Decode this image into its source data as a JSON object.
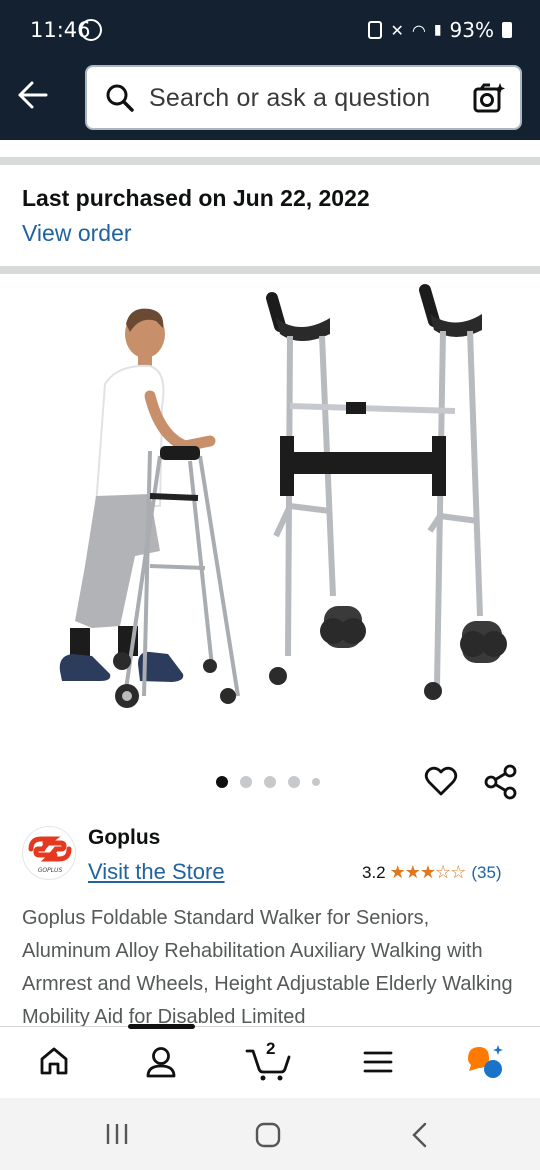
{
  "status_bar": {
    "time": "11:46",
    "battery": "93%"
  },
  "search": {
    "placeholder": "Search or ask a question"
  },
  "purchase": {
    "title": "Last purchased on Jun 22, 2022",
    "link": "View order"
  },
  "product": {
    "image_alt": "Goplus foldable standard walker with armrest and wheels",
    "carousel": {
      "count": 5,
      "active": 0
    },
    "brand": "Goplus",
    "brand_logo_text": "GOPLUS",
    "visit_store": "Visit the Store",
    "rating": "3.2",
    "stars": 3.2,
    "review_count": "(35)",
    "title": "Goplus Foldable Standard Walker for Seniors, Aluminum Alloy Rehabilitation Auxiliary Walking with Armrest and Wheels, Height Adjustable Elderly Walking Mobility Aid for Disabled Limited"
  },
  "bottom_nav": {
    "items": [
      {
        "icon": "home-icon"
      },
      {
        "icon": "account-icon"
      },
      {
        "icon": "cart-icon",
        "badge": "2"
      },
      {
        "icon": "menu-icon"
      },
      {
        "icon": "rufus-icon"
      }
    ]
  },
  "colors": {
    "header_bg": "#132130",
    "link": "#2162a1",
    "star": "#de7921",
    "brand_red": "#e4381f"
  }
}
